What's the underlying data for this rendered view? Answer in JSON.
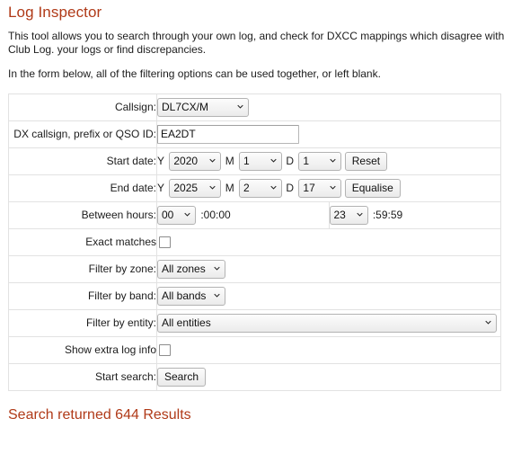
{
  "page": {
    "title": "Log Inspector",
    "intro_paragraph_1": "This tool allows you to search through your own log, and check for DXCC mappings which disagree with Club Log. your logs or find discrepancies.",
    "intro_paragraph_2": "In the form below, all of the filtering options can be used together, or left blank.",
    "title_color": "#b03a18",
    "results_heading": "Search returned 644 Results"
  },
  "form": {
    "callsign": {
      "label": "Callsign:",
      "value": "DL7CX/M"
    },
    "dx_callsign": {
      "label": "DX callsign, prefix or QSO ID:",
      "value": "EA2DT",
      "placeholder": ""
    },
    "start_date": {
      "label": "Start date:",
      "year_prefix": "Y",
      "year": "2020",
      "month_prefix": "M",
      "month": "1",
      "day_prefix": "D",
      "day": "1",
      "button": "Reset"
    },
    "end_date": {
      "label": "End date:",
      "year_prefix": "Y",
      "year": "2025",
      "month_prefix": "M",
      "month": "2",
      "day_prefix": "D",
      "day": "17",
      "button": "Equalise"
    },
    "between_hours": {
      "label": "Between hours:",
      "from_hour": "00",
      "from_suffix": ":00:00",
      "to_hour": "23",
      "to_suffix": ":59:59"
    },
    "exact_matches": {
      "label": "Exact matches",
      "checked": false
    },
    "filter_zone": {
      "label": "Filter by zone:",
      "value": "All zones"
    },
    "filter_band": {
      "label": "Filter by band:",
      "value": "All bands"
    },
    "filter_entity": {
      "label": "Filter by entity:",
      "value": "All entities"
    },
    "show_extra": {
      "label": "Show extra log info",
      "checked": false
    },
    "start_search": {
      "label": "Start search:",
      "button": "Search"
    }
  },
  "icons": {
    "chevron_down": "chevron-down-icon"
  }
}
